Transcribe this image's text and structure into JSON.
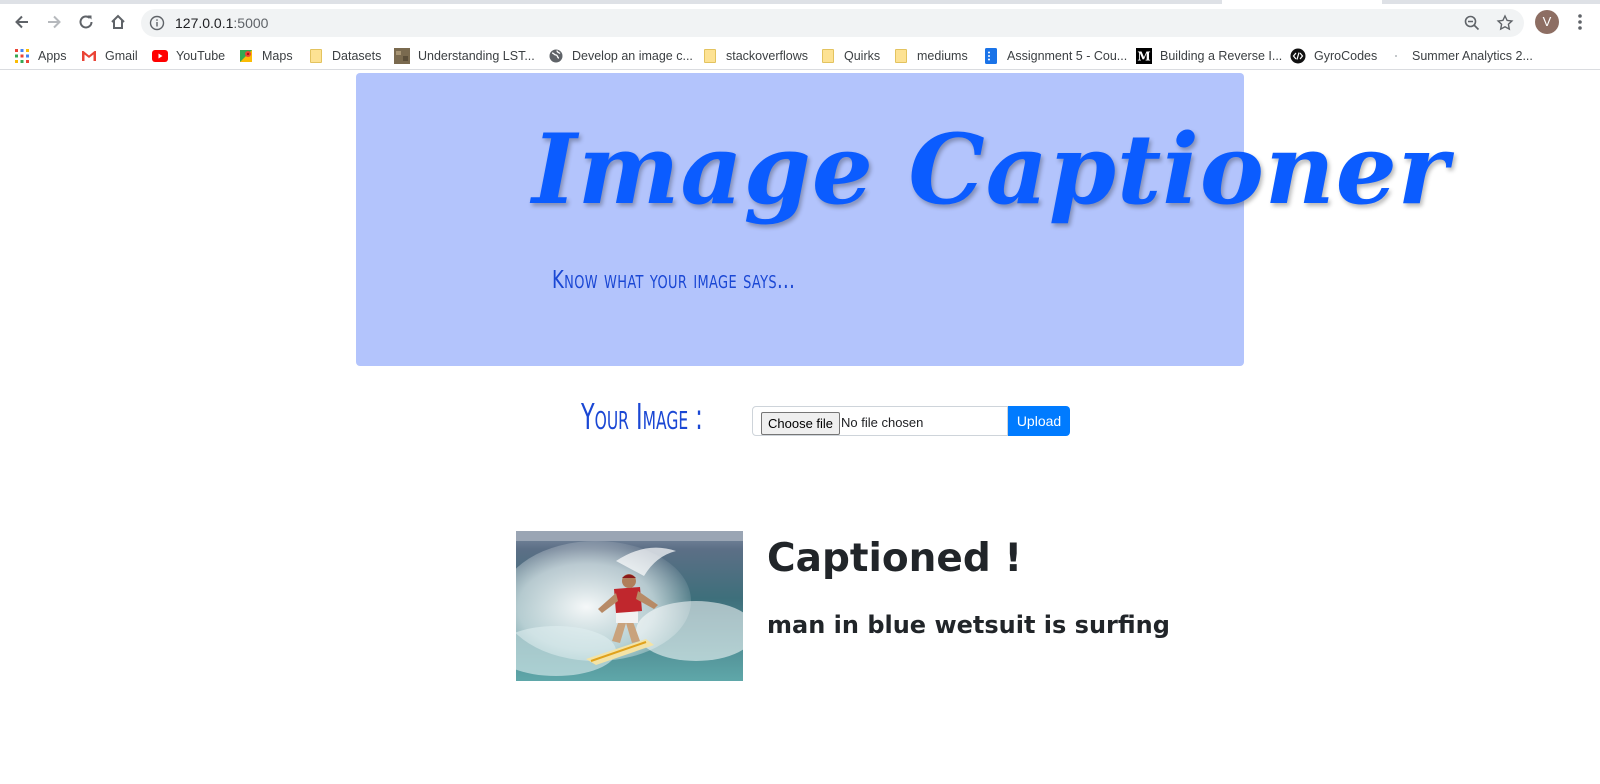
{
  "browser": {
    "url_host": "127.0.0.1",
    "url_port": ":5000",
    "avatar_initial": "V",
    "bookmarks": [
      {
        "label": "Apps",
        "icon": "apps-grid-icon"
      },
      {
        "label": "Gmail",
        "icon": "gmail-icon"
      },
      {
        "label": "YouTube",
        "icon": "youtube-icon"
      },
      {
        "label": "Maps",
        "icon": "maps-icon"
      },
      {
        "label": "Datasets",
        "icon": "folder-icon"
      },
      {
        "label": "Understanding LST...",
        "icon": "thumbnail-icon"
      },
      {
        "label": "Develop an image c...",
        "icon": "globe-icon"
      },
      {
        "label": "stackoverflows",
        "icon": "folder-icon"
      },
      {
        "label": "Quirks",
        "icon": "folder-icon"
      },
      {
        "label": "mediums",
        "icon": "folder-icon"
      },
      {
        "label": "Assignment 5 - Cou...",
        "icon": "docs-icon"
      },
      {
        "label": "Building a Reverse I...",
        "icon": "medium-icon"
      },
      {
        "label": "GyroCodes",
        "icon": "code-icon"
      },
      {
        "label": "Summer Analytics 2...",
        "icon": "dot-icon"
      }
    ]
  },
  "page": {
    "brand_title": "Image Captioner",
    "brand_subtitle": "Know what your image says...",
    "upload": {
      "label": "Your Image :",
      "choose_button": "Choose file",
      "file_status": "No file chosen",
      "submit_label": "Upload"
    },
    "result": {
      "heading": "Captioned !",
      "caption": "man in blue wetsuit is surfing"
    }
  },
  "colors": {
    "jumbotron_bg": "#b3c4fc",
    "brand_blue": "#0b5cff",
    "subtitle_blue": "#1a47d4",
    "upload_button": "#007bff"
  }
}
